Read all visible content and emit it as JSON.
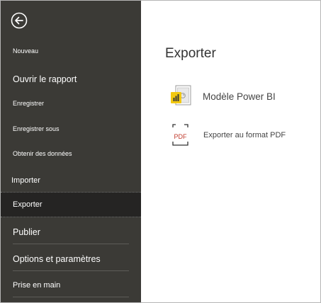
{
  "sidebar": {
    "back_icon": "back-arrow-icon",
    "items": [
      {
        "label": "Nouveau"
      },
      {
        "label": "Ouvrir le rapport"
      },
      {
        "label": "Enregistrer"
      },
      {
        "label": "Enregistrer sous"
      },
      {
        "label": "Obtenir des données"
      },
      {
        "label": "Importer"
      },
      {
        "label": "Exporter",
        "selected": true
      },
      {
        "label": "Publier"
      },
      {
        "label": "Options et paramètres"
      },
      {
        "label": "Prise en main"
      }
    ]
  },
  "main": {
    "title": "Exporter",
    "options": [
      {
        "label": "Modèle Power BI",
        "icon": "powerbi-template-icon"
      },
      {
        "label": "Exporter au format PDF",
        "icon": "pdf-file-icon",
        "icon_text": "PDF"
      }
    ]
  },
  "colors": {
    "sidebar_bg": "#3b3a36",
    "selected_bg": "#252423",
    "accent_yellow": "#f2c811"
  }
}
